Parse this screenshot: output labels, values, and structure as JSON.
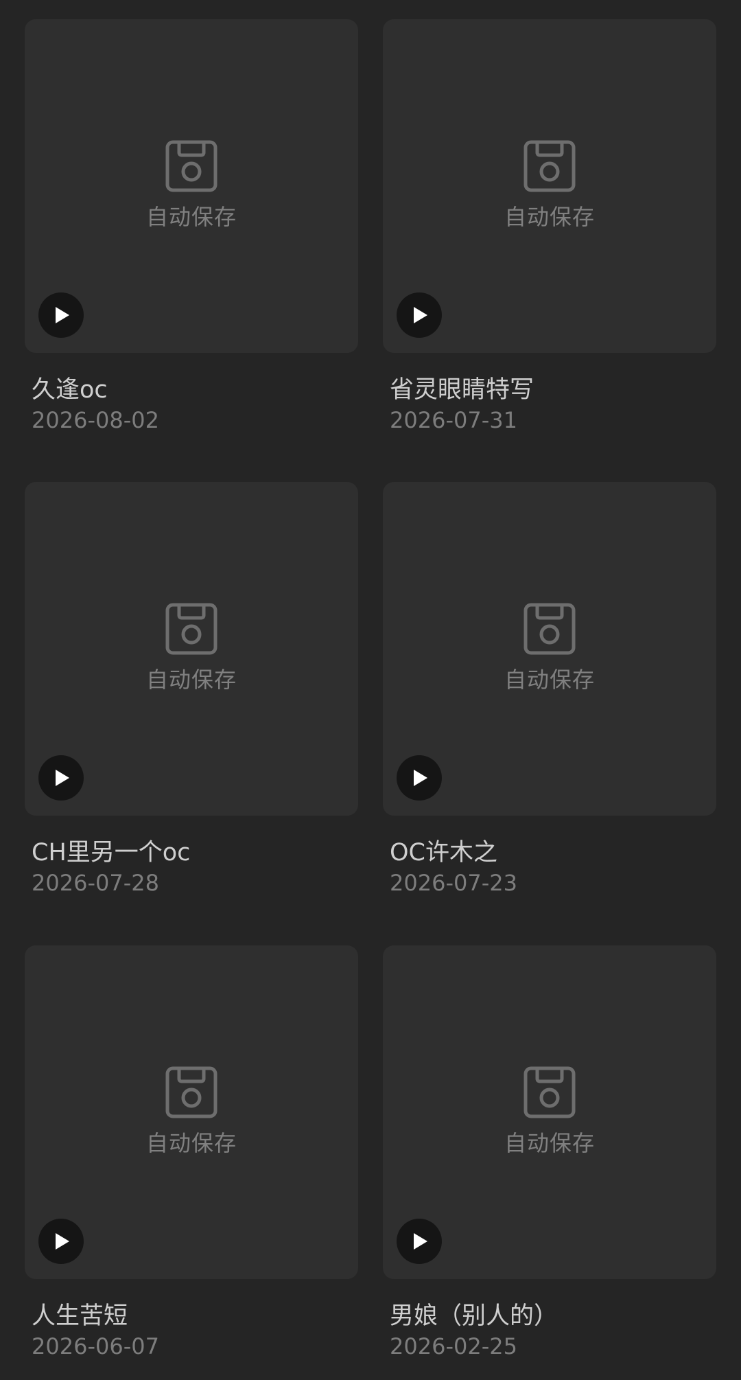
{
  "autosave_label": "自动保存",
  "icons": {
    "thumbnail": "floppy-disk-icon",
    "play": "play-icon"
  },
  "colors": {
    "background": "#252525",
    "card": "#2f2f2f",
    "icon": "#6e6e6e",
    "title": "#cfcfcf",
    "date": "#7d7d7d",
    "play_bg": "#151515"
  },
  "projects": [
    {
      "title": "久逢oc",
      "date": "2026-08-02"
    },
    {
      "title": "省灵眼睛特写",
      "date": "2026-07-31"
    },
    {
      "title": "CH里另一个oc",
      "date": "2026-07-28"
    },
    {
      "title": "OC许木之",
      "date": "2026-07-23"
    },
    {
      "title": "人生苦短",
      "date": "2026-06-07"
    },
    {
      "title": "男娘（别人的）",
      "date": "2026-02-25"
    }
  ]
}
